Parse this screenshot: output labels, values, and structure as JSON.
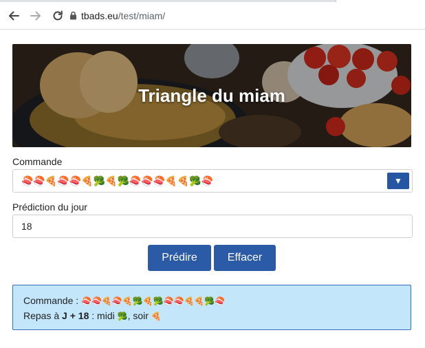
{
  "browser": {
    "url_domain": "tbads.eu",
    "url_path": "/test/miam/"
  },
  "hero": {
    "title": "Triangle du miam"
  },
  "commande": {
    "label": "Commande",
    "value": "🍣🍣🍕🍣🍣🍕🥦🍕🥦🍣🍣🍣🍕🍕🥦🍣"
  },
  "prediction": {
    "label": "Prédiction du jour",
    "value": "18"
  },
  "buttons": {
    "predict": "Prédire",
    "clear": "Effacer"
  },
  "result": {
    "commande_label": "Commande :",
    "commande_value": "🍣🍣🍕🍣🍕🥦🍕🥦🍣🍣🍕🍕🥦🍣",
    "repas_prefix": "Repas à",
    "repas_day": "J + 18",
    "repas_midi_text": ": midi",
    "repas_midi_emoji": "🥦",
    "repas_soir_text": ", soir",
    "repas_soir_emoji": "🍕"
  }
}
